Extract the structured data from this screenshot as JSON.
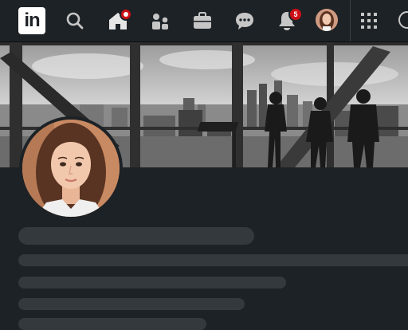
{
  "nav": {
    "logo_text": "in",
    "icons": [
      "search-icon",
      "home-icon",
      "my-network-icon",
      "jobs-icon",
      "messaging-icon",
      "notifications-icon",
      "apps-grid-icon",
      "profile-menu-icon"
    ],
    "notifications_count": "5",
    "accent_color": "#cc1016"
  },
  "banner": {
    "description_colors": {
      "sky": "#d9d9d9",
      "frame": "#2f2f2f"
    }
  },
  "theme": {
    "background": "#1d2226",
    "skeleton": "#34393e"
  }
}
